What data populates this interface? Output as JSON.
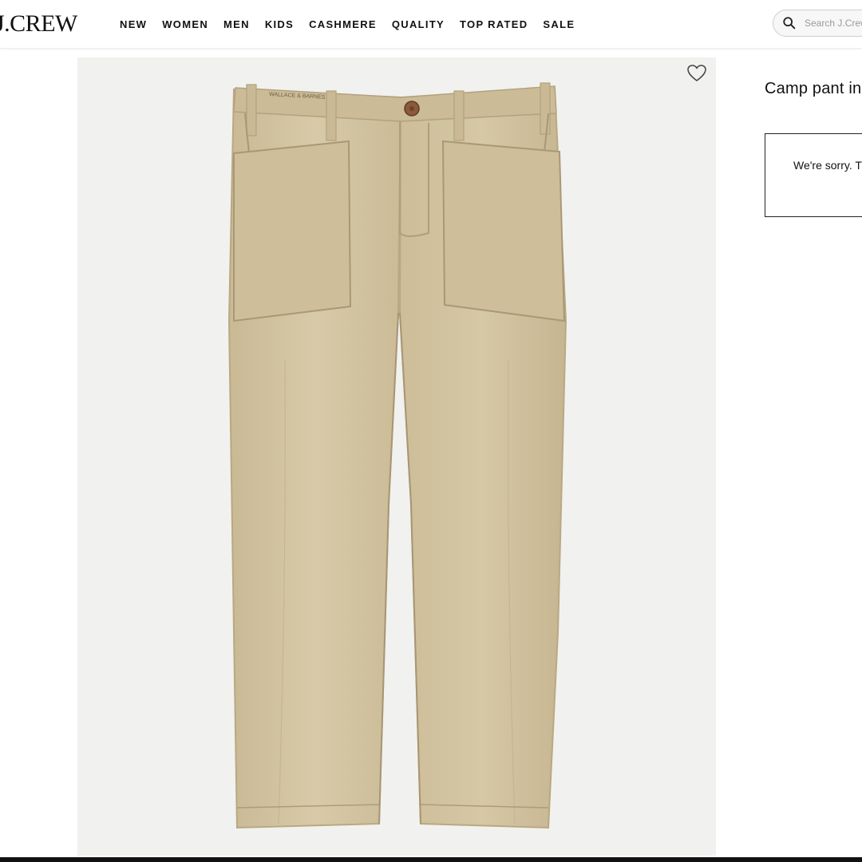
{
  "header": {
    "logo": "J.CREW",
    "nav": [
      "NEW",
      "WOMEN",
      "MEN",
      "KIDS",
      "CASHMERE",
      "QUALITY",
      "TOP RATED",
      "SALE"
    ],
    "search_placeholder": "Search J.Crew"
  },
  "product": {
    "image_label": "WALLACE & BARNES",
    "title": "Camp pant in",
    "notice": "We're sorry. T"
  },
  "icons": {
    "search": "search-icon",
    "wishlist": "heart-icon"
  },
  "colors": {
    "pant_fabric": "#d2c3a0",
    "pant_shadow": "#bfae89",
    "image_bg": "#f1f1ef",
    "button": "#8a5a3a"
  }
}
